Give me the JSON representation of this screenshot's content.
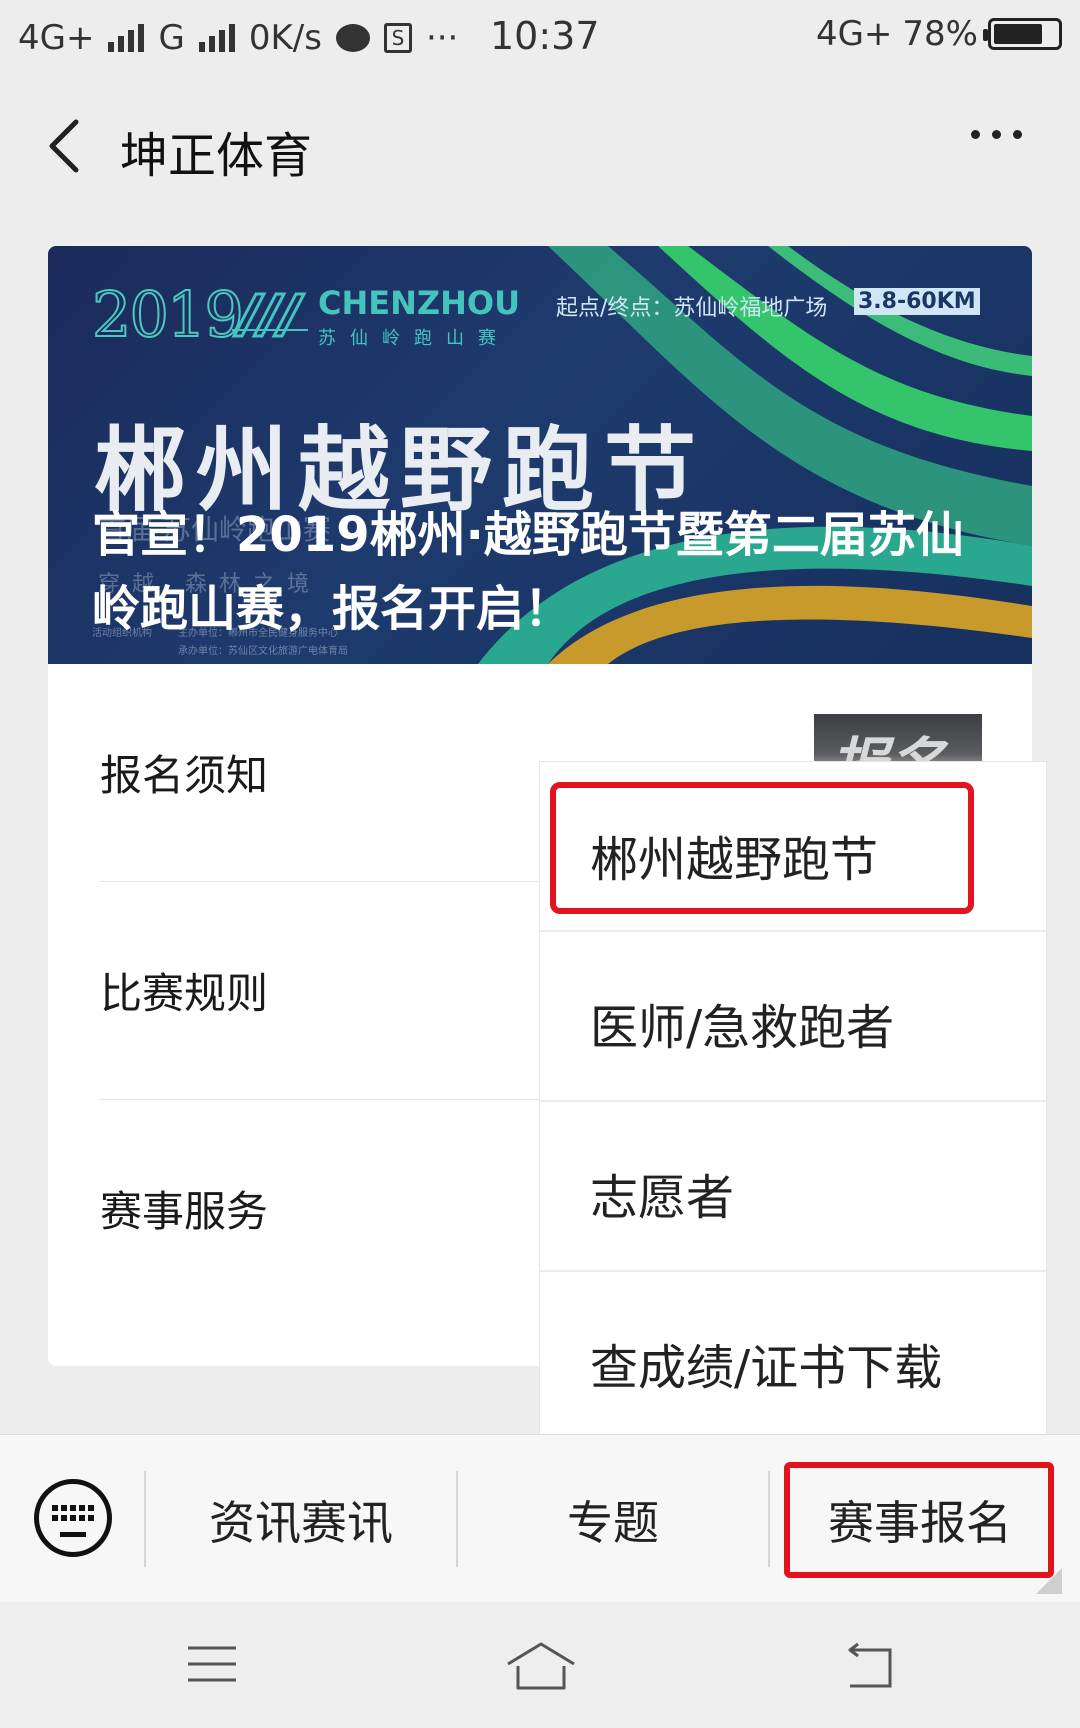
{
  "status_bar": {
    "network1": "4G+",
    "network2": "G",
    "speed": "0K/s",
    "s_icon": "S",
    "dots": "···",
    "time": "10:37",
    "network3": "4G",
    "plus": "+",
    "battery": "78%",
    "battery_level": 0.78
  },
  "header": {
    "title": "坤正体育",
    "back_icon": "chevron-left-icon",
    "more_icon": "more-dots-icon"
  },
  "banner": {
    "year": "2019",
    "brand": "CHENZHOU",
    "brand_sub": "苏仙岭跑山赛",
    "route": "起点/终点：苏仙岭福地广场",
    "distance": "3.8-60KM",
    "headline": "郴州越野跑节",
    "ghost_line1": "首届 苏仙岭跑山赛",
    "ghost_line2": "穿越 森林之境",
    "small1": "活动组织机构",
    "small2": "主办单位：郴州市全民健身服务中心",
    "small3": "承办单位：苏仙区文化旅游广电体育局",
    "caption": "官宣！2019郴州·越野跑节暨第二届苏仙岭跑山赛，报名开启！",
    "colors": {
      "teal": "#2fb39a",
      "green": "#35c46f",
      "gold": "#c89a2c",
      "navy": "#1b2a5a"
    }
  },
  "menu": {
    "items": [
      {
        "label": "报名须知"
      },
      {
        "label": "比赛规则"
      },
      {
        "label": "赛事服务"
      }
    ],
    "enroll_thumb": "报名"
  },
  "popup": {
    "items": [
      {
        "label": "郴州越野跑节"
      },
      {
        "label": "医师/急救跑者"
      },
      {
        "label": "志愿者"
      },
      {
        "label": "查成绩/证书下载"
      }
    ],
    "highlight_color": "#e1131c"
  },
  "bottom_bar": {
    "keyboard_icon": "keyboard-icon",
    "tabs": [
      {
        "label": "资讯赛讯"
      },
      {
        "label": "专题"
      },
      {
        "label": "赛事报名"
      }
    ]
  },
  "system_nav": {
    "menu_icon": "hamburger-icon",
    "home_icon": "home-icon",
    "back_icon": "return-icon"
  }
}
